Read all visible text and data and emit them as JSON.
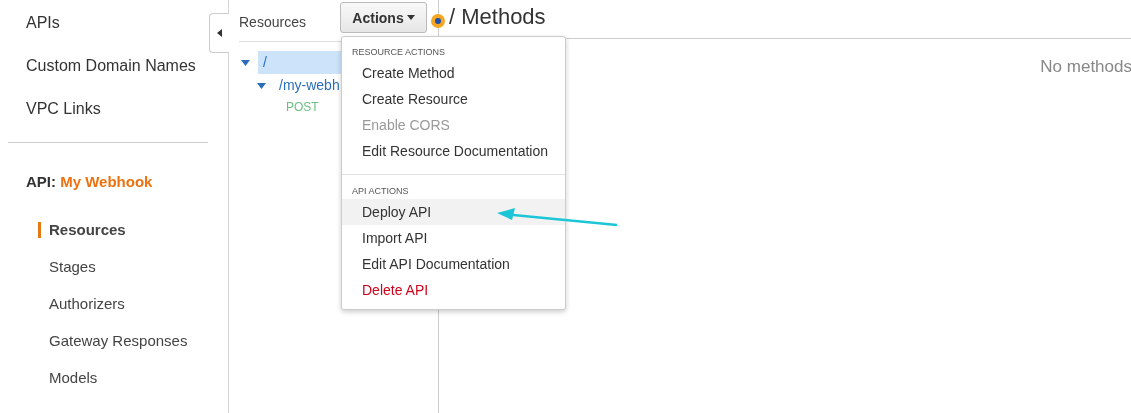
{
  "sidebar": {
    "top_items": [
      "APIs",
      "Custom Domain Names",
      "VPC Links"
    ],
    "api_label": "API:",
    "api_name": "My Webhook",
    "items": [
      {
        "label": "Resources",
        "selected": true
      },
      {
        "label": "Stages",
        "selected": false
      },
      {
        "label": "Authorizers",
        "selected": false
      },
      {
        "label": "Gateway Responses",
        "selected": false
      },
      {
        "label": "Models",
        "selected": false
      }
    ]
  },
  "resources_panel": {
    "title": "Resources",
    "actions_button": "Actions",
    "tree": [
      {
        "path": "/",
        "selected": true,
        "expanded": true,
        "children": [
          {
            "path": "/my-webh",
            "selected": false,
            "expanded": true,
            "methods": [
              "POST"
            ]
          }
        ]
      }
    ]
  },
  "main": {
    "title": "/ Methods",
    "empty_text": "No methods"
  },
  "actions_menu": [
    {
      "kind": "header",
      "label": "RESOURCE ACTIONS"
    },
    {
      "kind": "item",
      "label": "Create Method",
      "disabled": false,
      "danger": false,
      "highlighted": false
    },
    {
      "kind": "item",
      "label": "Create Resource",
      "disabled": false,
      "danger": false,
      "highlighted": false
    },
    {
      "kind": "item",
      "label": "Enable CORS",
      "disabled": true,
      "danger": false,
      "highlighted": false
    },
    {
      "kind": "item",
      "label": "Edit Resource Documentation",
      "disabled": false,
      "danger": false,
      "highlighted": false
    },
    {
      "kind": "divider"
    },
    {
      "kind": "header",
      "label": "API ACTIONS"
    },
    {
      "kind": "item",
      "label": "Deploy API",
      "disabled": false,
      "danger": false,
      "highlighted": true
    },
    {
      "kind": "item",
      "label": "Import API",
      "disabled": false,
      "danger": false,
      "highlighted": false
    },
    {
      "kind": "item",
      "label": "Edit API Documentation",
      "disabled": false,
      "danger": false,
      "highlighted": false
    },
    {
      "kind": "item",
      "label": "Delete API",
      "disabled": false,
      "danger": true,
      "highlighted": false
    }
  ]
}
